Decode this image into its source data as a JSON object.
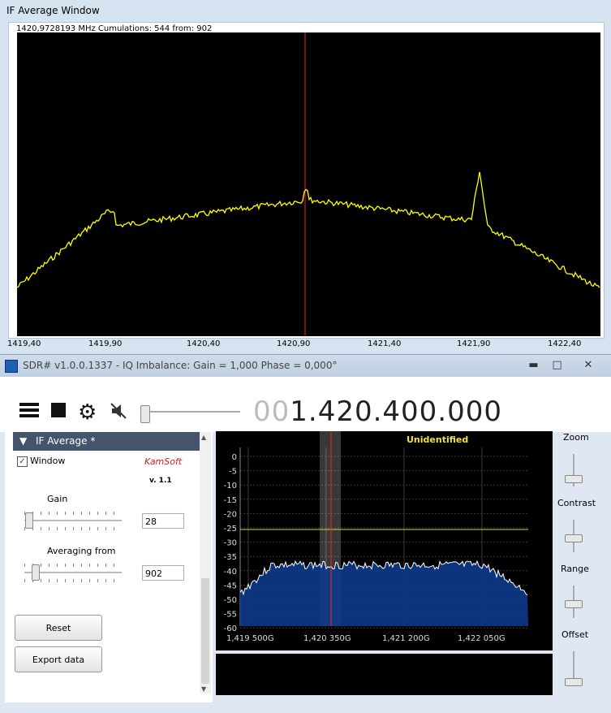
{
  "top_window": {
    "title": "IF Average Window",
    "info": "1420,9728193 MHz    Cumulations: 544 from: 902",
    "x_ticks": [
      "1419,40",
      "1419,90",
      "1420,40",
      "1420,90",
      "1421,40",
      "1421,90",
      "1422,40"
    ]
  },
  "main_window": {
    "title": "SDR# v1.0.0.1337 - IQ Imbalance: Gain = 1,000 Phase = 0,000°",
    "buttons": {
      "minimize": "▬",
      "maximize": "□",
      "close": "✕"
    }
  },
  "toolbar": {
    "frequency_dim": "00",
    "frequency": "1.420.400.000"
  },
  "if_panel": {
    "header": "IF Average *",
    "window_label": "Window",
    "window_checked": "✓",
    "brand": "KamSoft",
    "version": "v. 1.1",
    "gain_label": "Gain",
    "gain_value": "28",
    "averaging_label": "Averaging from",
    "averaging_value": "902",
    "reset_label": "Reset",
    "export_label": "Export data"
  },
  "spectrum": {
    "station": "Unidentified",
    "y_ticks": [
      "0",
      "-5",
      "-10",
      "-15",
      "-20",
      "-25",
      "-30",
      "-35",
      "-40",
      "-45",
      "-50",
      "-55",
      "-60"
    ],
    "x_ticks": [
      "1,419 500G",
      "1,420 350G",
      "1,421 200G",
      "1,422 050G"
    ]
  },
  "right_controls": {
    "zoom": "Zoom",
    "contrast": "Contrast",
    "range": "Range",
    "offset": "Offset"
  },
  "colors": {
    "trace": "#ffff00",
    "marker": "#ff2020",
    "spectrum_fill": "#0d3a8a"
  }
}
